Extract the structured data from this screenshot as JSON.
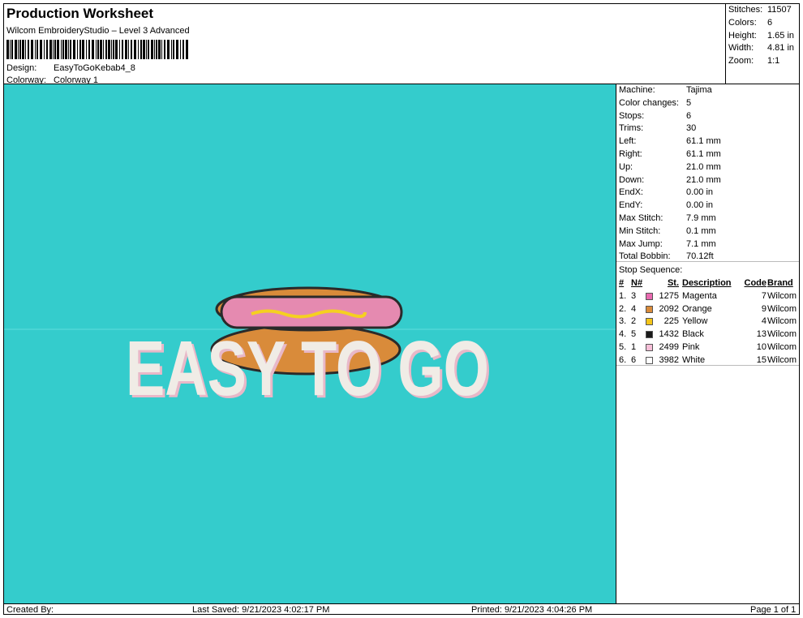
{
  "header": {
    "title": "Production Worksheet",
    "subtitle": "Wilcom EmbroideryStudio – Level 3 Advanced",
    "design_label": "Design:",
    "design_value": "EasyToGoKebab4_8",
    "colorway_label": "Colorway:",
    "colorway_value": "Colorway 1"
  },
  "top_stats": [
    {
      "label": "Stitches:",
      "value": "11507"
    },
    {
      "label": "Colors:",
      "value": "6"
    },
    {
      "label": "Height:",
      "value": "1.65 in"
    },
    {
      "label": "Width:",
      "value": "4.81 in"
    },
    {
      "label": "Zoom:",
      "value": "1:1"
    }
  ],
  "machine_info": [
    {
      "label": "Machine:",
      "value": "Tajima"
    },
    {
      "label": "Color changes:",
      "value": "5"
    },
    {
      "label": "Stops:",
      "value": "6"
    },
    {
      "label": "Trims:",
      "value": "30"
    },
    {
      "label": "Left:",
      "value": "61.1 mm"
    },
    {
      "label": "Right:",
      "value": "61.1 mm"
    },
    {
      "label": "Up:",
      "value": "21.0 mm"
    },
    {
      "label": "Down:",
      "value": "21.0 mm"
    },
    {
      "label": "EndX:",
      "value": "0.00 in"
    },
    {
      "label": "EndY:",
      "value": "0.00 in"
    },
    {
      "label": "Max Stitch:",
      "value": "7.9 mm"
    },
    {
      "label": "Min Stitch:",
      "value": "0.1 mm"
    },
    {
      "label": "Max Jump:",
      "value": "7.1 mm"
    },
    {
      "label": "Total Bobbin:",
      "value": "70.12ft"
    }
  ],
  "stop_sequence": {
    "label": "Stop Sequence:",
    "headers": {
      "idx": "#",
      "n": "N#",
      "st": "St.",
      "desc": "Description",
      "code": "Code",
      "brand": "Brand"
    },
    "rows": [
      {
        "idx": "1.",
        "n": "3",
        "color": "#e86ab0",
        "st": "1275",
        "desc": "Magenta",
        "code": "7",
        "brand": "Wilcom"
      },
      {
        "idx": "2.",
        "n": "4",
        "color": "#d98b3a",
        "st": "2092",
        "desc": "Orange",
        "code": "9",
        "brand": "Wilcom"
      },
      {
        "idx": "3.",
        "n": "2",
        "color": "#f5c518",
        "st": "225",
        "desc": "Yellow",
        "code": "4",
        "brand": "Wilcom"
      },
      {
        "idx": "4.",
        "n": "5",
        "color": "#1a1a1a",
        "st": "1432",
        "desc": "Black",
        "code": "13",
        "brand": "Wilcom"
      },
      {
        "idx": "5.",
        "n": "1",
        "color": "#f7bfd8",
        "st": "2499",
        "desc": "Pink",
        "code": "10",
        "brand": "Wilcom"
      },
      {
        "idx": "6.",
        "n": "6",
        "color": "#ffffff",
        "st": "3982",
        "desc": "White",
        "code": "15",
        "brand": "Wilcom"
      }
    ]
  },
  "design_preview": {
    "text": "EASY TO GO",
    "background": "#34cccc",
    "bun_color": "#d98b3a",
    "sausage_color": "#e58ab0",
    "mustard_color": "#f5d020",
    "outline_color": "#2a2a2a",
    "text_color": "#f0ece6",
    "shadow_color": "#e8b8c8"
  },
  "footer": {
    "created_by": "Created By:",
    "last_saved": "Last Saved: 9/21/2023 4:02:17 PM",
    "printed": "Printed: 9/21/2023 4:04:26 PM",
    "page": "Page 1 of 1"
  }
}
